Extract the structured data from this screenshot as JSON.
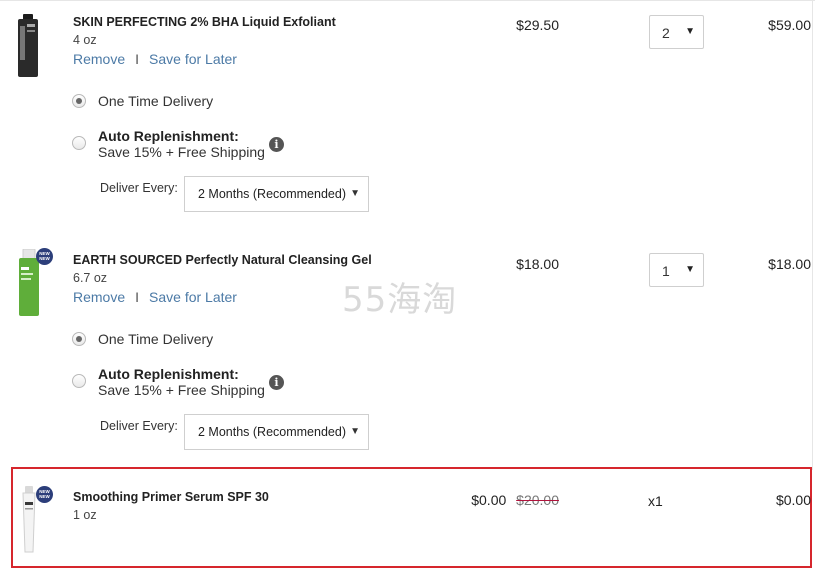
{
  "items": [
    {
      "title": "SKIN PERFECTING 2% BHA Liquid Exfoliant",
      "size": "4 oz",
      "remove_label": "Remove",
      "separator": "I",
      "save_label": "Save for Later",
      "price": "$29.50",
      "qty": "2",
      "total": "$59.00",
      "one_time_label": "One Time Delivery",
      "auto_label": "Auto Replenishment:",
      "auto_sub": "Save 15% + Free Shipping",
      "deliver_label": "Deliver Every:",
      "deliver_value": "2 Months (Recommended)"
    },
    {
      "title": "EARTH SOURCED Perfectly Natural Cleansing Gel",
      "size": "6.7 oz",
      "remove_label": "Remove",
      "separator": "I",
      "save_label": "Save for Later",
      "price": "$18.00",
      "qty": "1",
      "total": "$18.00",
      "one_time_label": "One Time Delivery",
      "auto_label": "Auto Replenishment:",
      "auto_sub": "Save 15% + Free Shipping",
      "deliver_label": "Deliver Every:",
      "deliver_value": "2 Months (Recommended)",
      "badge": "NEW NEW"
    },
    {
      "title": "Smoothing Primer Serum SPF 30",
      "size": "1 oz",
      "price": "$0.00",
      "original_price": "$20.00",
      "qty": "x1",
      "total": "$0.00",
      "badge": "NEW NEW"
    }
  ],
  "icons": {
    "info": "info-icon",
    "caret": "caret-down-icon"
  },
  "info_glyph": "i",
  "caret_glyph": "▼",
  "watermark": "55海淘",
  "colors": {
    "link": "#4c7aa6",
    "highlight": "#d6262d",
    "strike": "#b0143c",
    "badge": "#2c3e7a"
  }
}
